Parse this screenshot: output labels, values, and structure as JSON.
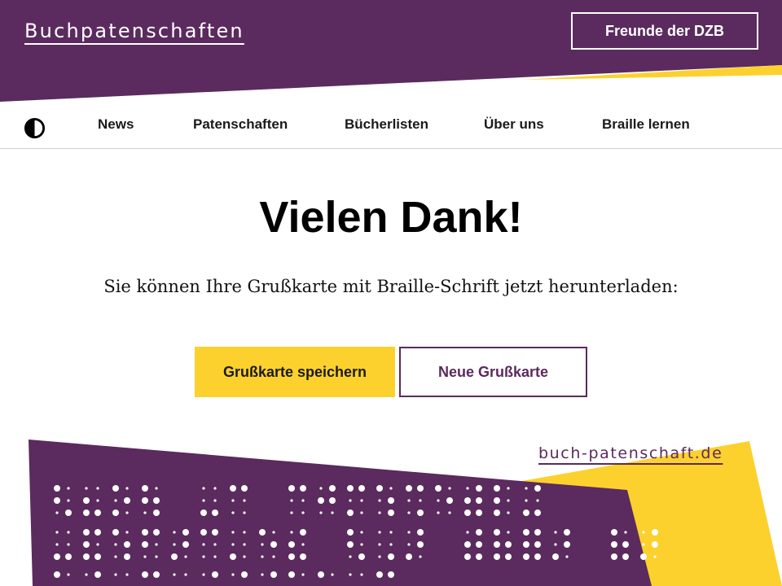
{
  "colors": {
    "purple": "#5b2a5e",
    "yellow": "#fcd12d",
    "white": "#ffffff"
  },
  "header": {
    "brand": "Buchpatenschaften",
    "friends_button": "Freunde der DZB"
  },
  "nav": {
    "contrast_icon": "contrast-toggle-icon",
    "items": [
      "News",
      "Patenschaften",
      "Bücherlisten",
      "Über uns",
      "Braille lernen"
    ]
  },
  "main": {
    "title": "Vielen Dank!",
    "message": "Sie können Ihre Grußkarte mit Braille-Schrift jetzt herunterladen:",
    "save_button": "Grußkarte speichern",
    "new_button": "Neue Grußkarte"
  },
  "card": {
    "url": "buch-patenschaft.de"
  }
}
